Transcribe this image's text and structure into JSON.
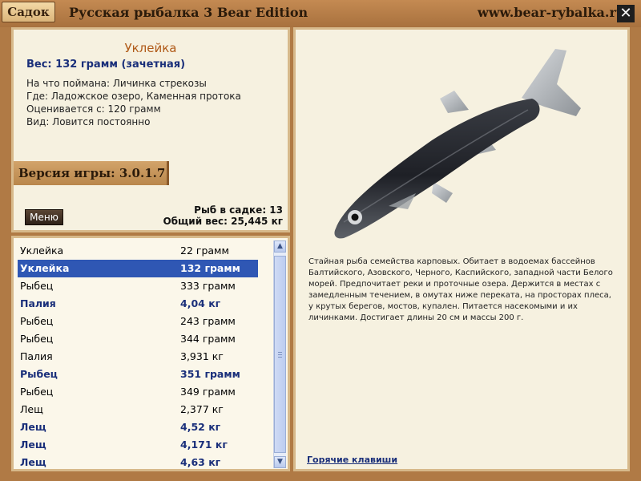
{
  "window": {
    "tab_label": "Садок",
    "title": "Русская рыбалка 3 Bear Edition",
    "url": "www.bear-rybalka.ru",
    "close_glyph": "✕"
  },
  "fish": {
    "name": "Уклейка",
    "weight_line": "Вес: 132 грамм (зачетная)",
    "caught_on": "На что поймана: Личинка стрекозы",
    "where": "Где: Ладожское озеро, Каменная протока",
    "valued_from": "Оценивается с: 120 грамм",
    "kind": "Вид: Ловится постоянно",
    "description": "Стайная рыба семейства карповых. Обитает в водоемах бассейнов Балтийского, Азовского, Черного, Каспийского, западной части Белого морей. Предпочитает реки и проточные озера. Держится в местах с замедленным течением, в омутах ниже переката, на просторах плеса, у крутых берегов, мостов, купален. Питается насекомыми и их личинками. Достигает длины 20 см и массы 200 г."
  },
  "version": "Версия игры: 3.0.1.7",
  "menu_label": "Меню",
  "stats": {
    "count": "Рыб в садке: 13",
    "total_weight": "Общий вес: 25,445 кг"
  },
  "catch_list": [
    {
      "name": "Уклейка",
      "weight": "22 грамм",
      "style": "normal"
    },
    {
      "name": "Уклейка",
      "weight": "132 грамм",
      "style": "selected"
    },
    {
      "name": "Рыбец",
      "weight": "333 грамм",
      "style": "normal"
    },
    {
      "name": "Палия",
      "weight": "4,04 кг",
      "style": "bold"
    },
    {
      "name": "Рыбец",
      "weight": "243 грамм",
      "style": "normal"
    },
    {
      "name": "Рыбец",
      "weight": "344 грамм",
      "style": "normal"
    },
    {
      "name": "Палия",
      "weight": "3,931 кг",
      "style": "normal"
    },
    {
      "name": "Рыбец",
      "weight": "351 грамм",
      "style": "bold"
    },
    {
      "name": "Рыбец",
      "weight": "349 грамм",
      "style": "normal"
    },
    {
      "name": "Лещ",
      "weight": "2,377 кг",
      "style": "normal"
    },
    {
      "name": "Лещ",
      "weight": "4,52 кг",
      "style": "bold"
    },
    {
      "name": "Лещ",
      "weight": "4,171 кг",
      "style": "bold"
    },
    {
      "name": "Лещ",
      "weight": "4,63 кг",
      "style": "bold"
    }
  ],
  "hotkeys_label": "Горячие клавиши",
  "colors": {
    "frame": "#b07a45",
    "panel": "#f6f1e0",
    "accent_blue": "#1a2f7a",
    "selection": "#2f57b4",
    "title_orange": "#b05a18"
  },
  "icons": {
    "close": "close-icon",
    "scroll_up": "scroll-up-icon",
    "scroll_down": "scroll-down-icon",
    "fish": "fish-image"
  }
}
